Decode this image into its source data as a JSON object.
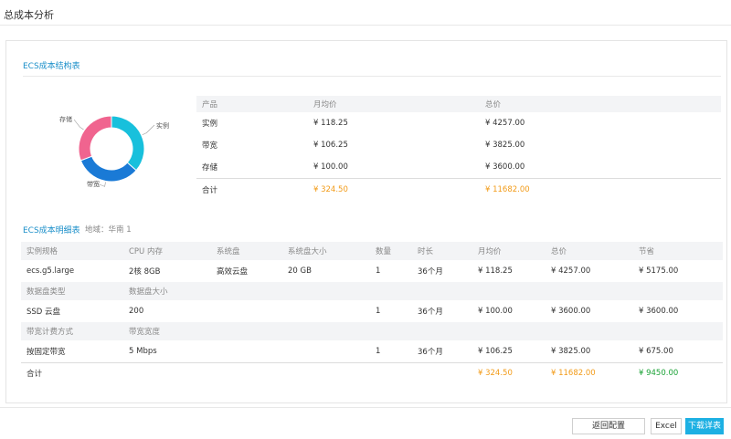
{
  "dialog": {
    "title": "总成本分析"
  },
  "structure": {
    "section_title": "ECS成本结构表",
    "chart_data": {
      "type": "pie",
      "categories": [
        "实例",
        "带宽",
        "存储"
      ],
      "values": [
        118.25,
        106.25,
        100.0
      ],
      "colors": [
        "#18c0dc",
        "#1a7ad6",
        "#f0648f"
      ]
    },
    "table": {
      "headers": [
        "产品",
        "月均价",
        "总价"
      ],
      "rows": [
        [
          "实例",
          "¥ 118.25",
          "¥ 4257.00"
        ],
        [
          "带宽",
          "¥ 106.25",
          "¥ 3825.00"
        ],
        [
          "存储",
          "¥ 100.00",
          "¥ 3600.00"
        ]
      ],
      "total": [
        "合计",
        "¥ 324.50",
        "¥ 11682.00"
      ]
    }
  },
  "detail": {
    "section_title": "ECS成本明细表",
    "region": "地域：华南 1",
    "headers": [
      "实例规格",
      "CPU 内存",
      "系统盘",
      "系统盘大小",
      "数量",
      "时长",
      "月均价",
      "总价",
      "节省"
    ],
    "instance_row": [
      "ecs.g5.large",
      "2核 8GB",
      "高效云盘",
      "20 GB",
      "1",
      "36个月",
      "¥ 118.25",
      "¥ 4257.00",
      "¥ 5175.00"
    ],
    "disk_headers": [
      "数据盘类型",
      "数据盘大小"
    ],
    "disk_row": [
      "SSD 云盘",
      "200",
      "",
      "",
      "1",
      "36个月",
      "¥ 100.00",
      "¥ 3600.00",
      "¥ 3600.00"
    ],
    "bw_headers": [
      "带宽计费方式",
      "带宽宽度"
    ],
    "bw_row": [
      "按固定带宽",
      "5 Mbps",
      "",
      "",
      "1",
      "36个月",
      "¥ 106.25",
      "¥ 3825.00",
      "¥ 675.00"
    ],
    "total": {
      "label": "合计",
      "monthly": "¥ 324.50",
      "total": "¥ 11682.00",
      "saved": "¥ 9450.00"
    }
  },
  "footer": {
    "back_label": "返回配置",
    "excel_label": "Excel",
    "download_label": "下载详表"
  }
}
